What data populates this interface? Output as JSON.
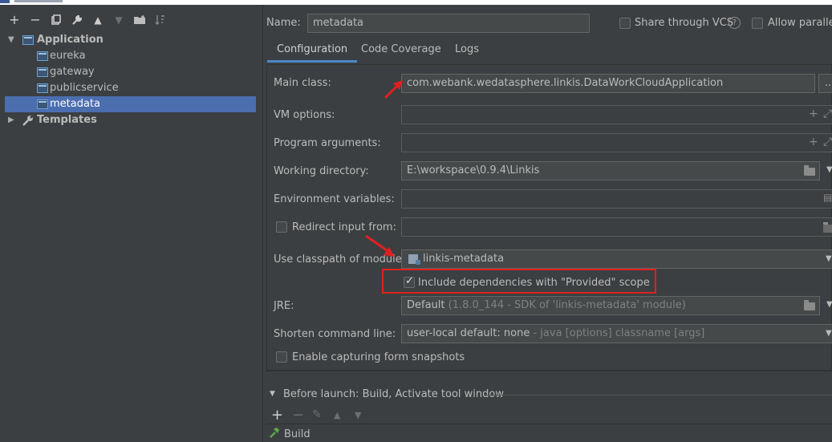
{
  "toolbar": {
    "add": "+",
    "remove": "−",
    "copy": "⧉",
    "edit": "🔧",
    "up": "▲",
    "down": "▼",
    "folder": "📁",
    "sort": "↓⃯"
  },
  "tree": {
    "application": "Application",
    "items": [
      "eureka",
      "gateway",
      "publicservice",
      "metadata"
    ],
    "templates": "Templates"
  },
  "name": {
    "label": "Name:",
    "value": "metadata"
  },
  "options": {
    "share_vcs": "Share through VCS",
    "help": "?",
    "allow_parallel": "Allow parallel"
  },
  "tabs": [
    "Configuration",
    "Code Coverage",
    "Logs"
  ],
  "fields": {
    "main_class": {
      "label": "Main class:",
      "value": "com.webank.wedatasphere.linkis.DataWorkCloudApplication",
      "browse": "..."
    },
    "vm_options": {
      "label": "VM options:",
      "value": ""
    },
    "program_args": {
      "label": "Program arguments:",
      "value": ""
    },
    "working_dir": {
      "label": "Working directory:",
      "value": "E:\\workspace\\0.9.4\\Linkis"
    },
    "env_vars": {
      "label": "Environment variables:",
      "value": ""
    },
    "redirect": {
      "label": "Redirect input from:",
      "value": ""
    },
    "classpath": {
      "label": "Use classpath of module:",
      "value": "linkis-metadata"
    },
    "include_provided": {
      "label": "Include dependencies with \"Provided\" scope",
      "checked": true
    },
    "jre": {
      "label": "JRE:",
      "value": "Default",
      "hint": "(1.8.0_144 - SDK of 'linkis-metadata' module)"
    },
    "shorten": {
      "label": "Shorten command line:",
      "value": "user-local default: none",
      "hint": "- java [options] classname [args]"
    },
    "snapshots": {
      "label": "Enable capturing form snapshots"
    }
  },
  "before_launch": {
    "title": "Before launch: Build, Activate tool window",
    "buttons": {
      "add": "+",
      "remove": "−",
      "edit": "✎",
      "up": "▲",
      "down": "▼"
    },
    "task": "Build"
  },
  "colors": {
    "background": "#3c3f41",
    "selection": "#4b6eaf",
    "annotation": "#e02020",
    "tab_underline": "#4a88c7"
  }
}
